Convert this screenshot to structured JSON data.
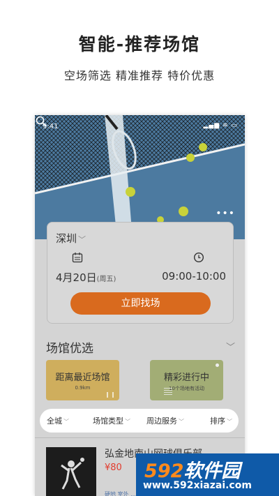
{
  "promo": {
    "title": "智能-推荐场馆",
    "subtitle": "空场筛选 精准推荐 特价优惠"
  },
  "status_bar": {
    "time": "9:41",
    "icons": "▂▄▆ ≋ ▭"
  },
  "hero": {
    "more_label": "•••"
  },
  "booking": {
    "city": "深圳",
    "date": "4月20日",
    "weekday": "(周五)",
    "time_range": "09:00-10:00",
    "find_button": "立即找场",
    "accent_color": "#d96a1e"
  },
  "section": {
    "title": "场馆优选"
  },
  "promo_cards": [
    {
      "title": "距离最近场馆",
      "subtitle": "0.9km",
      "color": "#cfae5d"
    },
    {
      "title": "精彩进行中",
      "subtitle": "10个场地有活动",
      "color": "#a2ad75"
    }
  ],
  "filters": [
    {
      "label": "全城"
    },
    {
      "label": "场馆类型"
    },
    {
      "label": "周边服务"
    },
    {
      "label": "排序"
    }
  ],
  "venue": {
    "name": "弘金地南山网球俱乐部",
    "price": "¥80",
    "tags": "硬地  室外  ..."
  },
  "watermark": {
    "brand_num": "592",
    "brand_text": "软件园",
    "url": "www.592xiazai.com"
  }
}
